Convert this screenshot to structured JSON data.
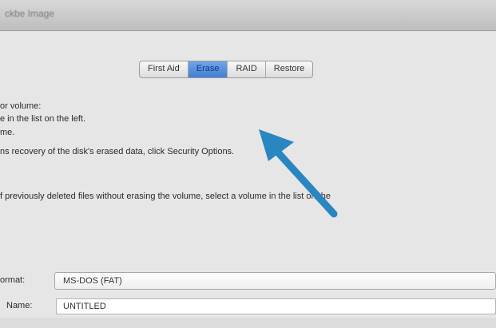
{
  "window": {
    "title": "ckbe Image"
  },
  "tabs": [
    {
      "label": "First Aid"
    },
    {
      "label": "Erase"
    },
    {
      "label": "RAID"
    },
    {
      "label": "Restore"
    }
  ],
  "body_text": {
    "line1": "or volume:",
    "line2": "e in the list on the left.",
    "line3": "me.",
    "line4": "ns recovery of the disk's erased data, click Security Options.",
    "line5": "f previously deleted files without erasing the volume, select a volume in the list on the"
  },
  "form": {
    "format_label": "ormat:",
    "format_value": "MS-DOS (FAT)",
    "name_label": "Name:",
    "name_value": "UNTITLED"
  },
  "colors": {
    "arrow": "#2a86c0",
    "selected_tab": "#4a89dc"
  },
  "icons": {
    "annotation_arrow": "arrow-pointing-up-left-icon"
  }
}
